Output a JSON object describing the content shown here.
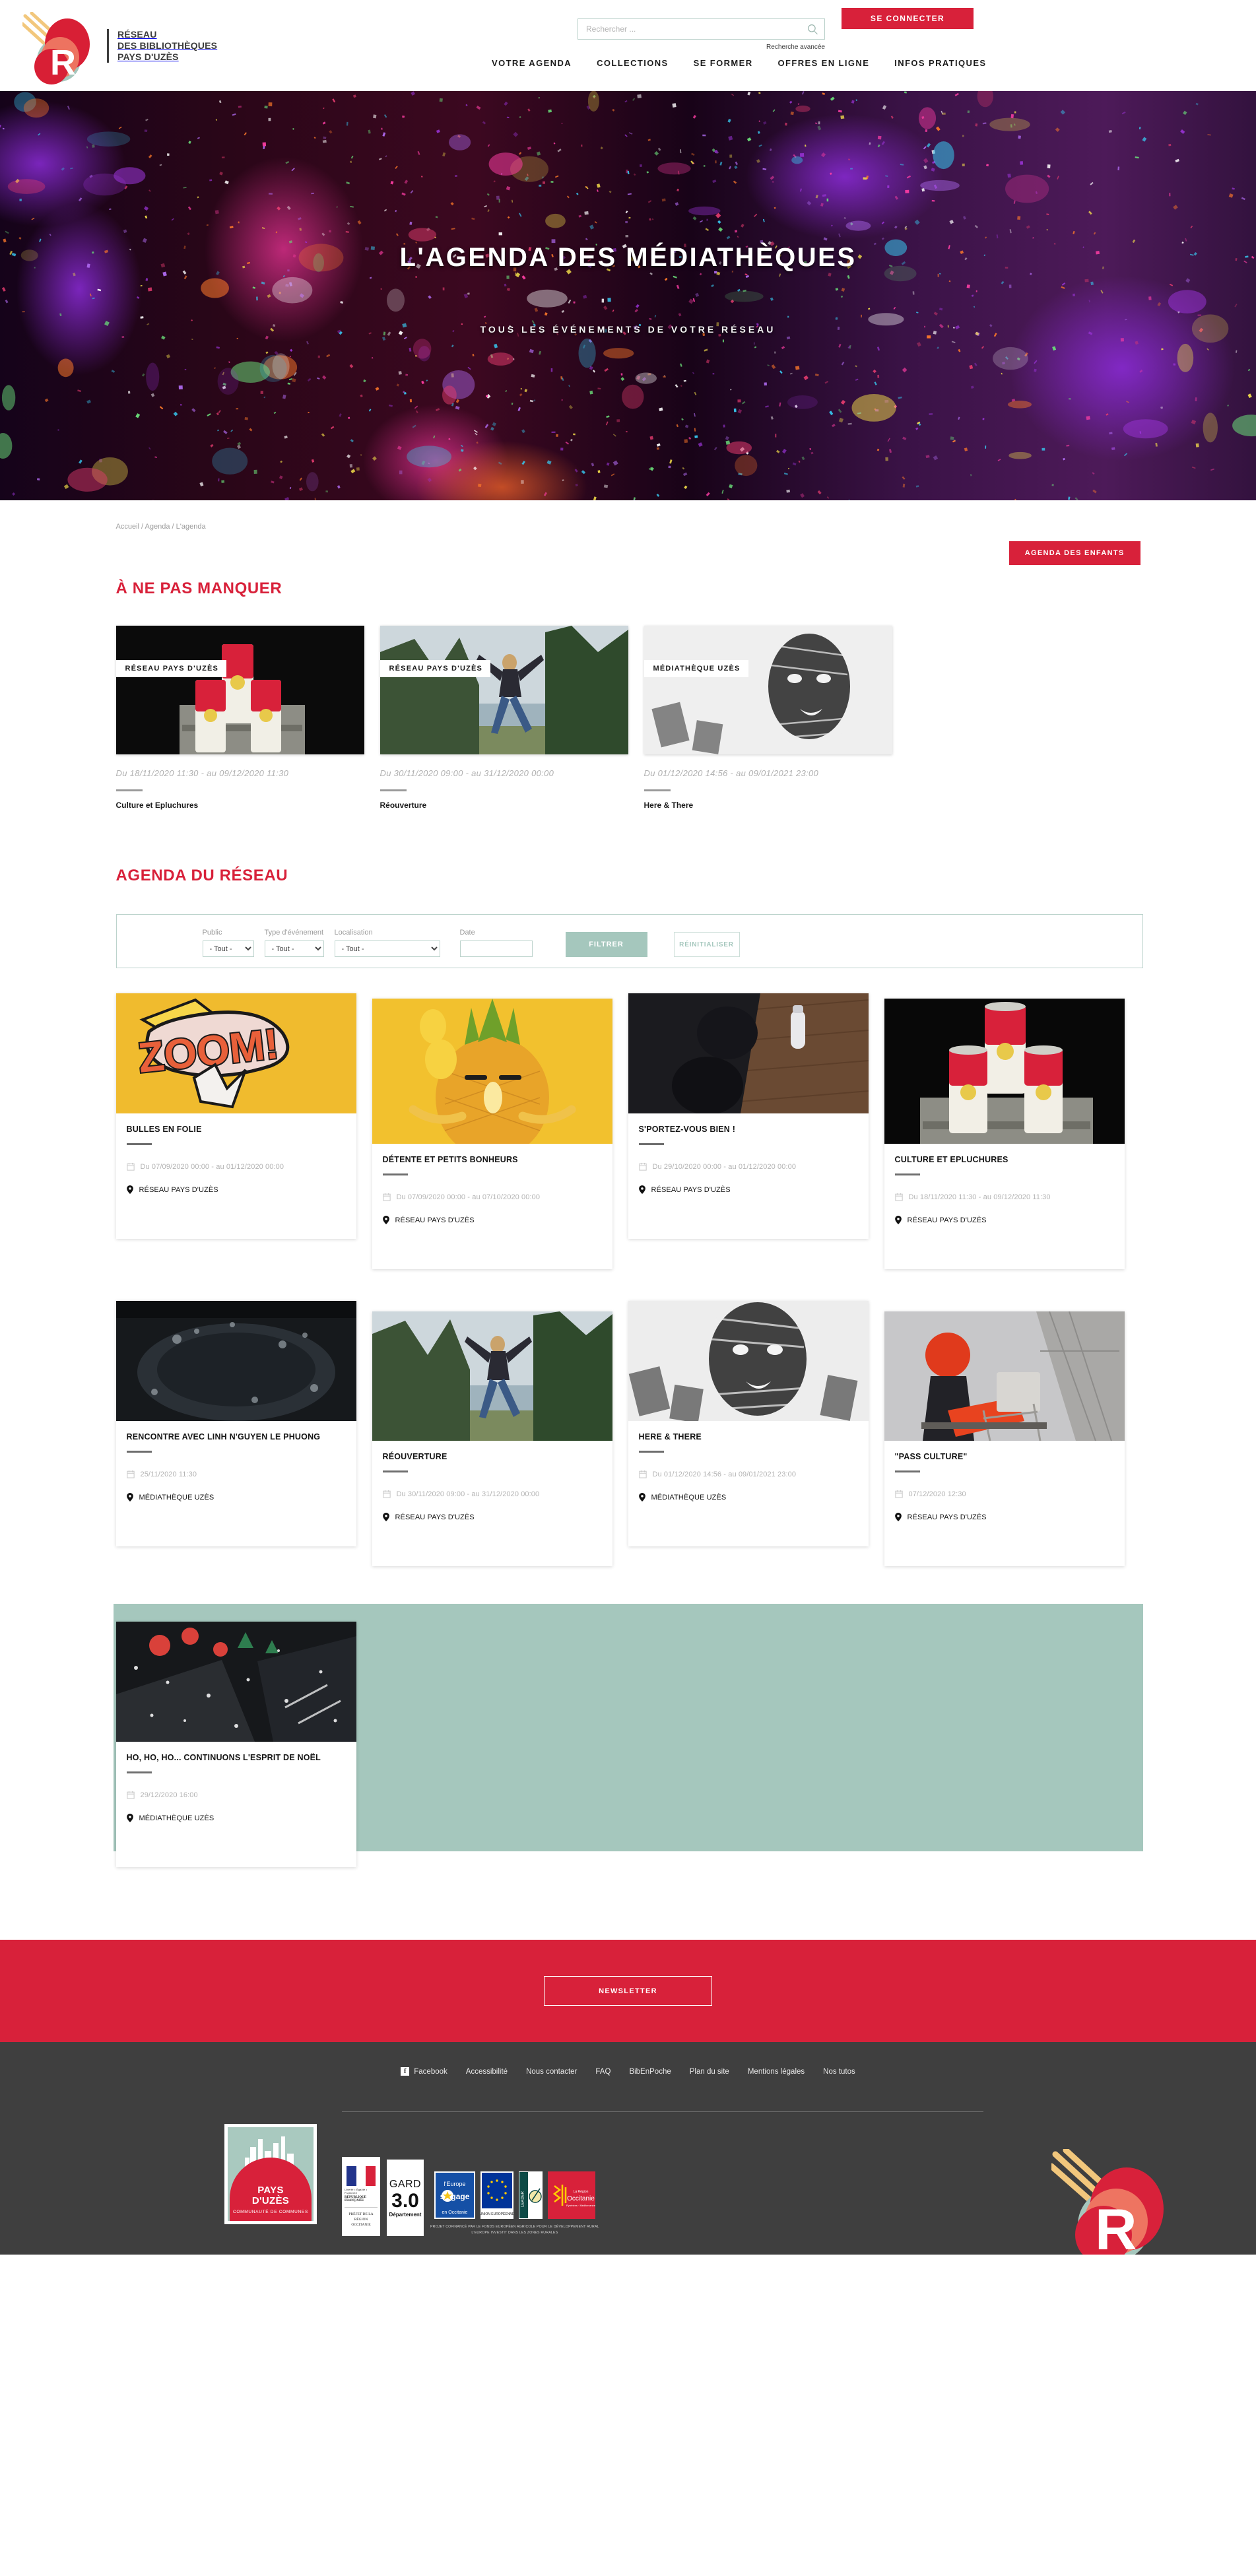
{
  "header": {
    "logo": {
      "letter": "R",
      "line1": "RÉSEAU",
      "line2": "DES BIBLIOTHÈQUES",
      "line3": "PAYS D'UZÈS"
    },
    "search": {
      "placeholder": "Rechercher ...",
      "value": "",
      "icon": "search-icon",
      "advanced_label": "Recherche avancée"
    },
    "connect_label": "SE CONNECTER",
    "nav": [
      {
        "label": "VOTRE AGENDA"
      },
      {
        "label": "COLLECTIONS"
      },
      {
        "label": "SE FORMER"
      },
      {
        "label": "OFFRES EN LIGNE"
      },
      {
        "label": "INFOS PRATIQUES"
      }
    ]
  },
  "hero": {
    "title": "L'AGENDA DES MÉDIATHÈQUES",
    "subtitle": "TOUS LES ÉVÉNEMENTS DE VOTRE RÉSEAU"
  },
  "breadcrumb": {
    "item1": "Accueil",
    "sep1": "/",
    "item2": "Agenda",
    "sep2": "/",
    "item3": "L'agenda"
  },
  "children_agenda_button": "AGENDA DES ENFANTS",
  "highlights_section": {
    "title": "À NE PAS MANQUER",
    "items": [
      {
        "tag": "RÉSEAU PAYS D'UZÈS",
        "date": "Du 18/11/2020 11:30 - au 09/12/2020 11:30",
        "name": "Culture et Epluchures"
      },
      {
        "tag": "RÉSEAU PAYS D'UZÈS",
        "date": "Du 30/11/2020 09:00 - au 31/12/2020 00:00",
        "name": "Réouverture"
      },
      {
        "tag": "MÉDIATHÈQUE UZÈS",
        "date": "Du 01/12/2020 14:56 - au 09/01/2021 23:00",
        "name": "Here & There"
      }
    ]
  },
  "agenda_section": {
    "title": "AGENDA DU RÉSEAU",
    "filters": {
      "public_label": "Public",
      "public_value": "- Tout -",
      "type_label": "Type d'événement",
      "type_value": "- Tout -",
      "location_label": "Localisation",
      "location_value": "- Tout -",
      "date_label": "Date",
      "date_value": "",
      "filter_button": "FILTRER",
      "reset_button": "RÉINITIALISER"
    },
    "events": [
      {
        "title": "BULLES EN FOLIE",
        "date": "Du 07/09/2020 00:00 - au 01/12/2020 00:00",
        "place": "RÉSEAU PAYS D'UZÈS"
      },
      {
        "title": "DÉTENTE ET PETITS BONHEURS",
        "date": "Du 07/09/2020 00:00 - au 07/10/2020 00:00",
        "place": "RÉSEAU PAYS D'UZÈS"
      },
      {
        "title": "S'PORTEZ-VOUS BIEN !",
        "date": "Du 29/10/2020 00:00 - au 01/12/2020 00:00",
        "place": "RÉSEAU PAYS D'UZÈS"
      },
      {
        "title": "CULTURE ET EPLUCHURES",
        "date": "Du 18/11/2020 11:30 - au 09/12/2020 11:30",
        "place": "RÉSEAU PAYS D'UZÈS"
      },
      {
        "title": "RENCONTRE AVEC LINH N'GUYEN LE PHUONG",
        "date": "25/11/2020 11:30",
        "place": "MÉDIATHÈQUE UZÈS"
      },
      {
        "title": "RÉOUVERTURE",
        "date": "Du 30/11/2020 09:00 - au 31/12/2020 00:00",
        "place": "RÉSEAU PAYS D'UZÈS"
      },
      {
        "title": "HERE & THERE",
        "date": "Du 01/12/2020 14:56 - au 09/01/2021 23:00",
        "place": "MÉDIATHÈQUE UZÈS"
      },
      {
        "title": "\"PASS CULTURE\"",
        "date": "07/12/2020 12:30",
        "place": "RÉSEAU PAYS D'UZÈS"
      },
      {
        "title": "HO, HO, HO... CONTINUONS L'ESPRIT DE NOËL",
        "date": "29/12/2020 16:00",
        "place": "MÉDIATHÈQUE UZÈS"
      }
    ]
  },
  "newsletter_button": "NEWSLETTER",
  "footer": {
    "links": [
      {
        "label": "Facebook",
        "icon": "facebook-icon"
      },
      {
        "label": "Accessibilité"
      },
      {
        "label": "Nous contacter"
      },
      {
        "label": "FAQ"
      },
      {
        "label": "BibEnPoche"
      },
      {
        "label": "Plan du site"
      },
      {
        "label": "Mentions légales"
      },
      {
        "label": "Nos tutos"
      }
    ],
    "pays_uzes_logo": {
      "line1": "PAYS",
      "line2": "D'UZÈS",
      "line3": "COMMUNAUTÉ DE COMMUNES"
    },
    "partners": {
      "prefet_liberty": "Liberté • Égalité • Fraternité",
      "prefet_republic": "RÉPUBLIQUE FRANÇAISE",
      "prefet_label": "PRÉFET DE LA RÉGION OCCITANIE",
      "gard_name": "GARD",
      "gard_number": "3.0",
      "gard_sub": "Département",
      "europe_line1": "l'Europe",
      "europe_line2": "s'engage",
      "europe_line3": "en Occitanie",
      "eu_label": "UNION EUROPÉENNE",
      "leader_label": "LEADER",
      "occitanie_region": "La Région",
      "occitanie_name": "Occitanie",
      "occitanie_sub": "Pyrénées · Méditerranée",
      "funding_line1": "PROJET COFINANCÉ PAR LE FONDS EUROPÉEN AGRICOLE POUR LE DÉVELOPPEMENT RURAL",
      "funding_line2": "L'EUROPE INVESTIT DANS LES ZONES RURALES"
    },
    "corner_logo_letter": "R"
  },
  "colors": {
    "brand_red": "#d8213a",
    "brand_teal": "#a5c7bd",
    "footer_gray": "#3f3f3f",
    "muted_text": "#b3b3b3"
  }
}
